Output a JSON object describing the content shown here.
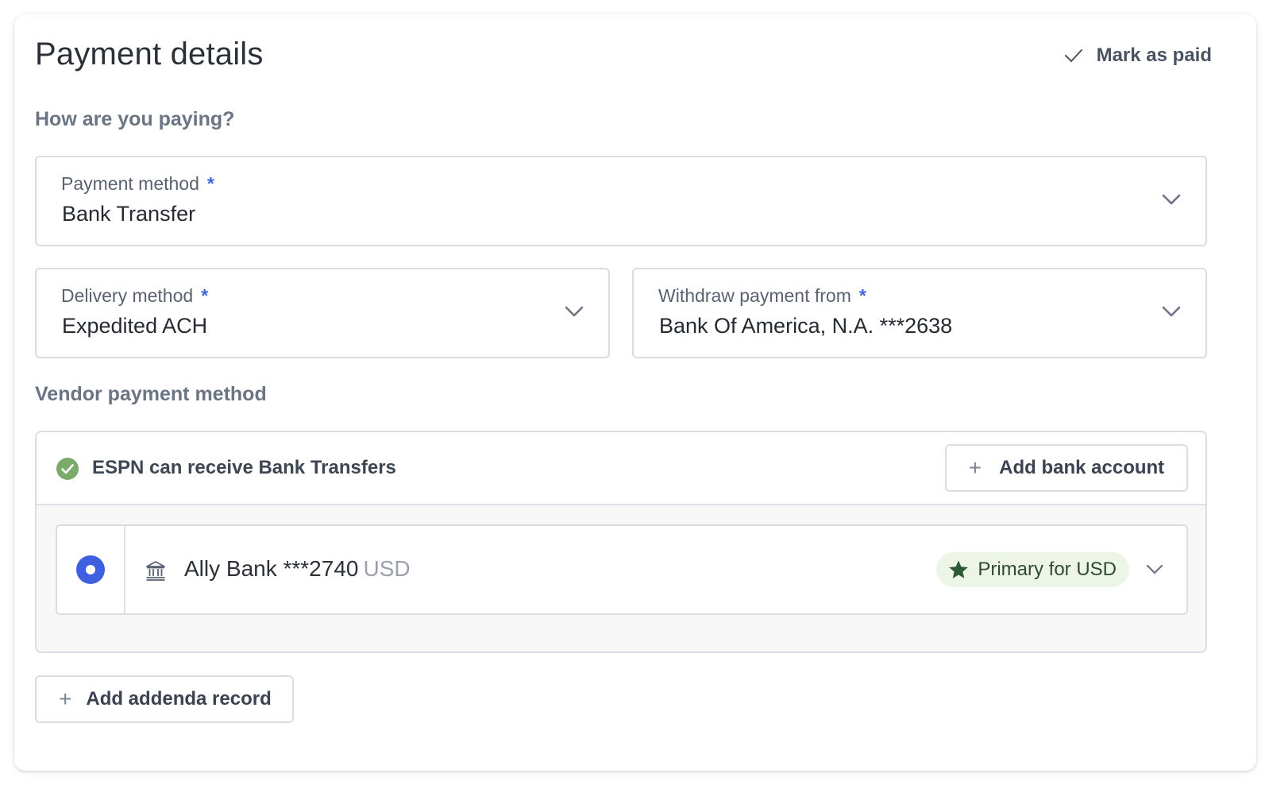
{
  "header": {
    "title": "Payment details",
    "mark_paid_label": "Mark as paid"
  },
  "sections": {
    "paying_label": "How are you paying?",
    "vendor_label": "Vendor payment method"
  },
  "fields": {
    "payment_method": {
      "label": "Payment method",
      "required": "*",
      "value": "Bank Transfer"
    },
    "delivery_method": {
      "label": "Delivery method",
      "required": "*",
      "value": "Expedited ACH"
    },
    "withdraw_from": {
      "label": "Withdraw payment from",
      "required": "*",
      "value": "Bank Of America, N.A. ***2638"
    }
  },
  "vendor": {
    "status_text": "ESPN can receive Bank Transfers",
    "add_bank_label": "Add bank account",
    "account": {
      "name": "Ally Bank ***2740",
      "currency": "USD",
      "badge": "Primary for USD",
      "selected": true
    }
  },
  "actions": {
    "add_addenda_label": "Add addenda record"
  },
  "colors": {
    "accent_blue": "#3f5fe0",
    "success_green": "#7aab6b",
    "badge_bg": "#edf5e6",
    "star_green": "#2f5a3a"
  },
  "icons": {
    "mark_paid": "check-icon",
    "status": "check-circle-icon",
    "add": "plus-icon",
    "bank": "bank-icon",
    "badge": "star-icon",
    "dropdown": "chevron-down-icon"
  }
}
